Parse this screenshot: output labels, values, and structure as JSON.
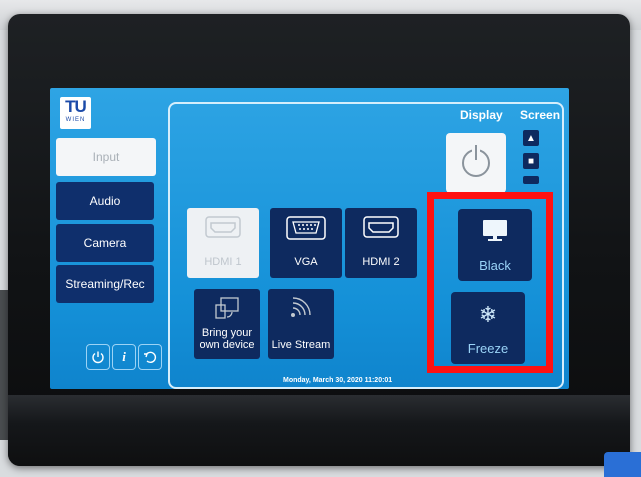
{
  "logo": {
    "line1": "TU",
    "line2": "WIEN"
  },
  "tabs": [
    {
      "label": "Input",
      "active": true
    },
    {
      "label": "Audio",
      "active": false
    },
    {
      "label": "Camera",
      "active": false
    },
    {
      "label": "Streaming/Rec",
      "active": false
    }
  ],
  "header": {
    "display": "Display",
    "screen": "Screen"
  },
  "sources": [
    {
      "label": "HDMI 1",
      "icon": "hdmi-icon",
      "active": true
    },
    {
      "label": "VGA",
      "icon": "vga-icon",
      "active": false
    },
    {
      "label": "HDMI 2",
      "icon": "hdmi-icon",
      "active": false
    },
    {
      "label": "Bring your own device",
      "icon": "screen-cast-icon",
      "active": false
    },
    {
      "label": "Live Stream",
      "icon": "wireless-icon",
      "active": false
    }
  ],
  "display_controls": {
    "black": "Black",
    "freeze": "Freeze"
  },
  "bottom_icons": [
    "power-icon",
    "info-icon",
    "undo-icon"
  ],
  "status": {
    "datetime": "Monday, March 30, 2020 11:20:01"
  },
  "colors": {
    "screen_blue": "#1591d8",
    "button_navy": "#0e2a5f",
    "highlight_red": "#ff1111"
  }
}
